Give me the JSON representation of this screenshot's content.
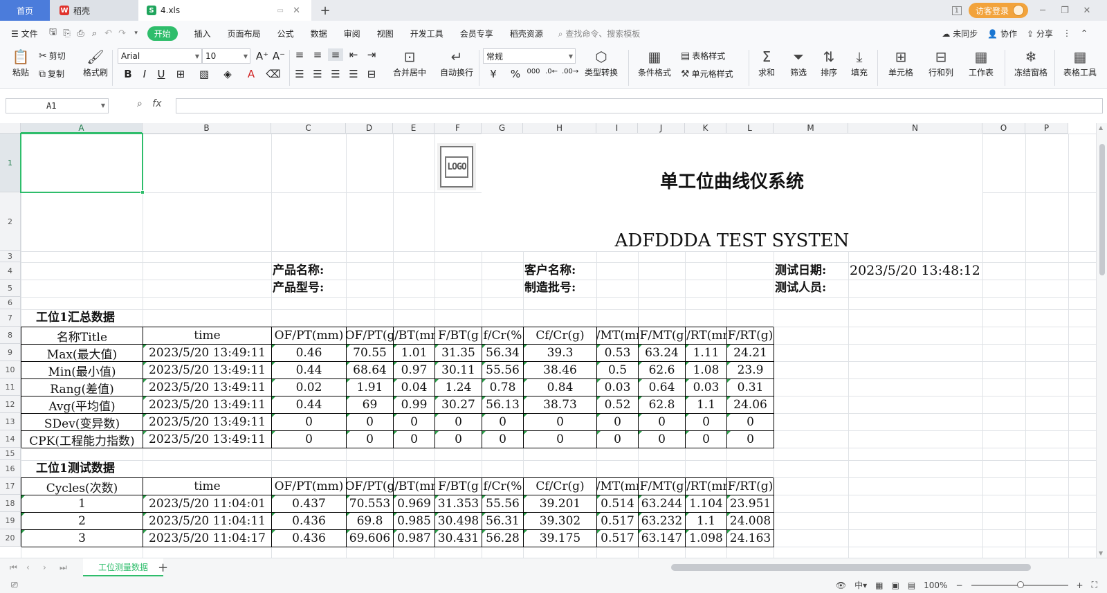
{
  "tabs": {
    "home": "首页",
    "docer": "稻壳",
    "file": "4.xls",
    "new_tab": "+",
    "page_badge": "1",
    "guest_login": "访客登录"
  },
  "menu": {
    "file": "文件",
    "items": [
      "开始",
      "插入",
      "页面布局",
      "公式",
      "数据",
      "审阅",
      "视图",
      "开发工具",
      "会员专享",
      "稻壳资源"
    ],
    "search": "查找命令、搜索模板",
    "unsynced": "未同步",
    "collaborate": "协作",
    "share": "分享"
  },
  "ribbon": {
    "paste": "粘贴",
    "cut": "剪切",
    "copy": "复制",
    "format_painter": "格式刷",
    "font_name": "Arial",
    "font_size": "10",
    "merge_center": "合并居中",
    "wrap_text": "自动换行",
    "number_format": "常规",
    "type_convert": "类型转换",
    "conditional_format": "条件格式",
    "table_style": "表格样式",
    "cell_style": "单元格样式",
    "sum": "求和",
    "filter": "筛选",
    "sort": "排序",
    "fill": "填充",
    "cell": "单元格",
    "row_col": "行和列",
    "worksheet": "工作表",
    "freeze": "冻结窗格",
    "table_tools": "表格工具"
  },
  "formula_bar": {
    "cell_ref": "A1",
    "fx": "fx",
    "value": ""
  },
  "columns": [
    "A",
    "B",
    "C",
    "D",
    "E",
    "F",
    "G",
    "H",
    "I",
    "J",
    "K",
    "L",
    "M",
    "N",
    "O",
    "P"
  ],
  "rows": [
    "1",
    "2",
    "3",
    "4",
    "5",
    "6",
    "7",
    "8",
    "9",
    "10",
    "11",
    "12",
    "13",
    "14",
    "15",
    "16",
    "17",
    "18",
    "19",
    "20"
  ],
  "sheet": {
    "logo": "LOGO",
    "title_cn": "单工位曲线仪系统",
    "title_en": "ADFDDDA TEST SYSTEN",
    "product_name": "产品名称:",
    "product_model": "产品型号:",
    "customer_name": "客户名称:",
    "batch_no": "制造批号:",
    "test_date_label": "测试日期:",
    "test_date": "2023/5/20 13:48:12",
    "tester_label": "测试人员:",
    "summary_title": "工位1汇总数据",
    "test_title": "工位1测试数据"
  },
  "summary_table": {
    "headers": [
      "名称Title",
      "time",
      "OF/PT(mm)",
      "OF/PT(g",
      "F/BT(mm",
      "F/BT(g",
      "f/Cr(%",
      "Cf/Cr(g)",
      "F/MT(mm",
      "F/MT(g",
      "F/RT(mm",
      "F/RT(g)"
    ],
    "rows": [
      [
        "Max(最大值)",
        "2023/5/20 13:49:11",
        "0.46",
        "70.55",
        "1.01",
        "31.35",
        "56.34",
        "39.3",
        "0.53",
        "63.24",
        "1.11",
        "24.21"
      ],
      [
        "Min(最小值)",
        "2023/5/20 13:49:11",
        "0.44",
        "68.64",
        "0.97",
        "30.11",
        "55.56",
        "38.46",
        "0.5",
        "62.6",
        "1.08",
        "23.9"
      ],
      [
        "Rang(差值)",
        "2023/5/20 13:49:11",
        "0.02",
        "1.91",
        "0.04",
        "1.24",
        "0.78",
        "0.84",
        "0.03",
        "0.64",
        "0.03",
        "0.31"
      ],
      [
        "Avg(平均值)",
        "2023/5/20 13:49:11",
        "0.44",
        "69",
        "0.99",
        "30.27",
        "56.13",
        "38.73",
        "0.52",
        "62.8",
        "1.1",
        "24.06"
      ],
      [
        "SDev(变异数)",
        "2023/5/20 13:49:11",
        "0",
        "0",
        "0",
        "0",
        "0",
        "0",
        "0",
        "0",
        "0",
        "0"
      ],
      [
        "CPK(工程能力指数)",
        "2023/5/20 13:49:11",
        "0",
        "0",
        "0",
        "0",
        "0",
        "0",
        "0",
        "0",
        "0",
        "0"
      ]
    ]
  },
  "test_table": {
    "headers": [
      "Cycles(次数)",
      "time",
      "OF/PT(mm)",
      "OF/PT(g",
      "F/BT(mm",
      "F/BT(g",
      "f/Cr(%",
      "Cf/Cr(g)",
      "F/MT(mm",
      "F/MT(g",
      "F/RT(mm",
      "F/RT(g)"
    ],
    "rows": [
      [
        "1",
        "2023/5/20 11:04:01",
        "0.437",
        "70.553",
        "0.969",
        "31.353",
        "55.56",
        "39.201",
        "0.514",
        "63.244",
        "1.104",
        "23.951"
      ],
      [
        "2",
        "2023/5/20 11:04:11",
        "0.436",
        "69.8",
        "0.985",
        "30.498",
        "56.31",
        "39.302",
        "0.517",
        "63.232",
        "1.1",
        "24.008"
      ],
      [
        "3",
        "2023/5/20 11:04:17",
        "0.436",
        "69.606",
        "0.987",
        "30.431",
        "56.28",
        "39.175",
        "0.517",
        "63.147",
        "1.098",
        "24.163"
      ]
    ]
  },
  "sheet_tabs": [
    "工位测量数据"
  ],
  "status": {
    "zoom": "100%"
  }
}
